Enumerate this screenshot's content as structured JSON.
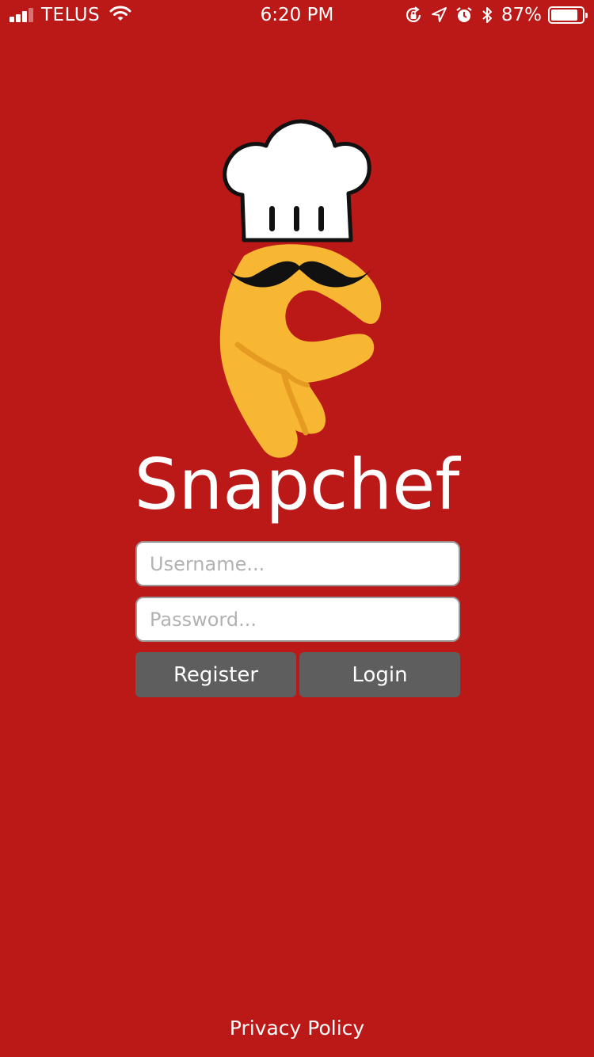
{
  "status_bar": {
    "carrier": "TELUS",
    "time": "6:20 PM",
    "battery_percent": "87%",
    "battery_level": 0.87,
    "icons": [
      "signal-icon",
      "wifi-icon",
      "rotation-lock-icon",
      "location-icon",
      "alarm-icon",
      "bluetooth-icon",
      "battery-icon"
    ]
  },
  "app": {
    "title": "Snapchef",
    "logo": "chef-hand-logo"
  },
  "form": {
    "username_placeholder": "Username...",
    "username_value": "",
    "password_placeholder": "Password...",
    "password_value": ""
  },
  "buttons": {
    "register": "Register",
    "login": "Login"
  },
  "footer": {
    "privacy_policy": "Privacy Policy"
  },
  "colors": {
    "background": "#bb1818",
    "button": "#5e5e5e",
    "logo_hand": "#f7b733",
    "text": "#ffffff"
  }
}
